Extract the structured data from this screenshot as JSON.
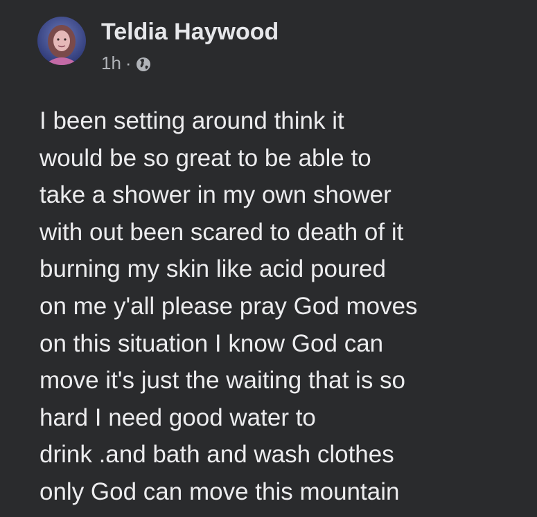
{
  "post": {
    "author_name": "Teldia Haywood",
    "timestamp": "1h",
    "separator": "·",
    "audience_icon": "globe-icon",
    "body": "I been setting around think it\nwould be so great to be able to\ntake a shower in my own shower\nwith out been scared to death of it\nburning my skin like acid poured\non me y'all please pray God moves\non this situation I know God can\nmove it's just the waiting that is so\nhard I need good water to\ndrink .and bath and wash clothes\nonly God can move this mountain"
  },
  "colors": {
    "background": "#2a2b2d",
    "text_primary": "#ececee",
    "text_secondary": "#b0b3b8"
  }
}
